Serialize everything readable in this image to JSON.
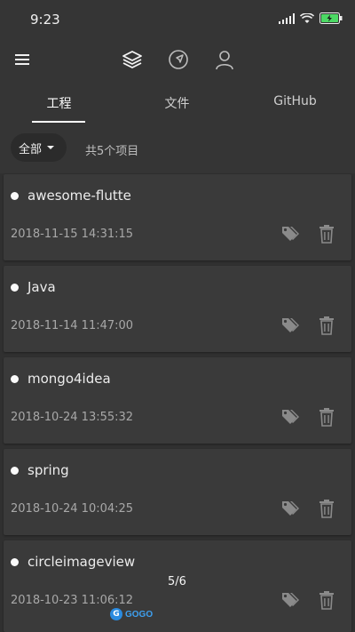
{
  "status": {
    "time": "9:23"
  },
  "appbar": {
    "icons": [
      "menu-icon",
      "layers-icon",
      "navigation-icon",
      "person-icon"
    ]
  },
  "tabs": [
    {
      "label": "工程",
      "active": true
    },
    {
      "label": "文件",
      "active": false
    },
    {
      "label": "GitHub",
      "active": false
    }
  ],
  "filter": {
    "selected": "全部",
    "count_text": "共5个项目"
  },
  "projects": [
    {
      "name": "awesome-flutte",
      "date": "2018-11-15 14:31:15"
    },
    {
      "name": "Java",
      "date": "2018-11-14 11:47:00"
    },
    {
      "name": "mongo4idea",
      "date": "2018-10-24 13:55:32"
    },
    {
      "name": "spring",
      "date": "2018-10-24 10:04:25"
    },
    {
      "name": "circleimageview",
      "date": "2018-10-23 11:06:12"
    }
  ],
  "pager": {
    "text": "5/6"
  },
  "watermark": {
    "letter": "G",
    "text": "GOGO"
  },
  "colors": {
    "background": "#303030",
    "card": "#3a3a3a",
    "topbar": "#353535",
    "accent": "#ffffff"
  }
}
